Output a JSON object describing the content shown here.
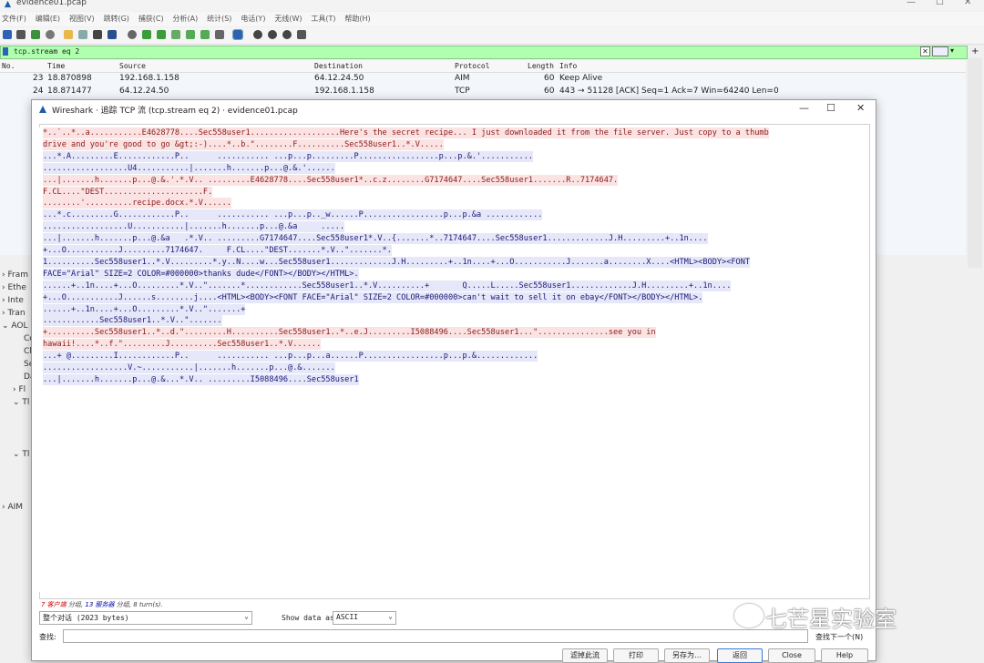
{
  "window": {
    "title": "evidence01.pcap"
  },
  "menu": [
    "文件(F)",
    "编辑(E)",
    "视图(V)",
    "跳转(G)",
    "捕获(C)",
    "分析(A)",
    "统计(S)",
    "电话(Y)",
    "无线(W)",
    "工具(T)",
    "帮助(H)"
  ],
  "filter": {
    "value": "tcp.stream eq 2"
  },
  "packet_list": {
    "headers": {
      "no": "No.",
      "time": "Time",
      "source": "Source",
      "destination": "Destination",
      "protocol": "Protocol",
      "length": "Length",
      "info": "Info"
    },
    "rows": [
      {
        "no": "23",
        "time": "18.870898",
        "source": "192.168.1.158",
        "destination": "64.12.24.50",
        "protocol": "AIM",
        "length": "60",
        "info": "Keep Alive"
      },
      {
        "no": "24",
        "time": "18.871477",
        "source": "64.12.24.50",
        "destination": "192.168.1.158",
        "protocol": "TCP",
        "length": "60",
        "info": "443 → 51128 [ACK] Seq=1 Ack=7 Win=64240 Len=0"
      }
    ]
  },
  "tree": [
    "Fram",
    "Ethe",
    "Inte",
    "Tran",
    "AOL",
    "Co",
    "Cl",
    "Se",
    "Da",
    "Fl",
    "Tl",
    "Tl",
    "AIM"
  ],
  "dialog": {
    "title": "Wireshark · 追踪 TCP 流 (tcp.stream eq 2) · evidence01.pcap",
    "lines": [
      {
        "t": "c",
        "text": "*..`..*..a...........E4628778....Sec558user1...................Here's the secret recipe... I just downloaded it from the file server. Just copy to a thumb"
      },
      {
        "t": "c",
        "text": "drive and you're good to go &gt;:-)....*..b.\"........F..........Sec558user1..*.V....."
      },
      {
        "t": "s",
        "text": "...*.A.........E............P..      ........... ...p...p.........P.................p...p.&.'..........."
      },
      {
        "t": "s",
        "text": "..................U4...........|.......h.......p...@.&.'......"
      },
      {
        "t": "c",
        "text": "...|.......h.......p...@.&.'.*.V.. .........E4628778....Sec558user1*..c.z........G7174647....Sec558user1.......R..7174647."
      },
      {
        "t": "c",
        "text": "F.CL....\"DEST.....................F."
      },
      {
        "t": "c",
        "text": "........'..........recipe.docx.*.V......"
      },
      {
        "t": "s",
        "text": "...*.c.........G............P..      ........... ...p...p.._w......P.................p...p.&a ............"
      },
      {
        "t": "s",
        "text": "..................U...........|.......h.......p...@.&a     ....."
      },
      {
        "t": "s",
        "text": "...|.......h.......p...@.&a   .*.V.. .........G7174647....Sec558user1*.V..{.......*..7174647....Sec558user1.............J.H.........+..1n...."
      },
      {
        "t": "s",
        "text": "+...O...........J.........7174647.     F.CL....\"DEST.......*.V..\".......*."
      },
      {
        "t": "s",
        "text": "1..........Sec558user1..*.V.........*.y..N....w...Sec558user1.............J.H.........+..1n....+...O...........J.......a........X....<HTML><BODY><FONT"
      },
      {
        "t": "s",
        "text": "FACE=\"Arial\" SIZE=2 COLOR=#000000>thanks dude</FONT></BODY></HTML>."
      },
      {
        "t": "s",
        "text": "......+..1n....+...O.........*.V..\".......*............Sec558user1..*.V..........+       Q.....L.....Sec558user1.............J.H.........+..1n...."
      },
      {
        "t": "s",
        "text": "+...O...........J......s........j....<HTML><BODY><FONT FACE=\"Arial\" SIZE=2 COLOR=#000000>can't wait to sell it on ebay</FONT></BODY></HTML>."
      },
      {
        "t": "s",
        "text": "......+..1n....+...O.........*.V..\".......+"
      },
      {
        "t": "s",
        "text": "............Sec558user1..*.V..\"......."
      },
      {
        "t": "c",
        "text": "+..........Sec558user1..*..d.\".........H..........Sec558user1..*..e.J.........I5088496....Sec558user1...\"...............see you in"
      },
      {
        "t": "c",
        "text": "hawaii!....*..f.\".........J..........Sec558user1..*.V......"
      },
      {
        "t": "s",
        "text": "...+ @.........I............P..      ........... ...p...p...a......P.................p...p.&............."
      },
      {
        "t": "s",
        "text": "..................V.~...........|.......h.......p...@.&......."
      },
      {
        "t": "s",
        "text": "...|.......h.......p...@.&...*.V.. .........I5088496....Sec558user1"
      }
    ],
    "summary": {
      "client": "7 客户端",
      "sep1": " 分组, ",
      "server": "13 服务器",
      "sep2": " 分组, 8 turn(s)."
    },
    "conversation": "整个对话 (2023 bytes)",
    "show_data_as_label": "Show data as",
    "show_data_as": "ASCII",
    "find_label": "查找:",
    "find_next": "查找下一个(N)",
    "buttons": {
      "filter_out": "滤掉此流",
      "print": "打印",
      "save_as": "另存为…",
      "back": "返回",
      "close": "Close",
      "help": "Help"
    }
  },
  "watermark": "七芒星实验室",
  "colors": {
    "filter_bg": "#afffaf",
    "client_bg": "#fbe3e3",
    "client_fg": "#8b1a1a",
    "server_bg": "#e6e7f8",
    "server_fg": "#1a1a78"
  }
}
